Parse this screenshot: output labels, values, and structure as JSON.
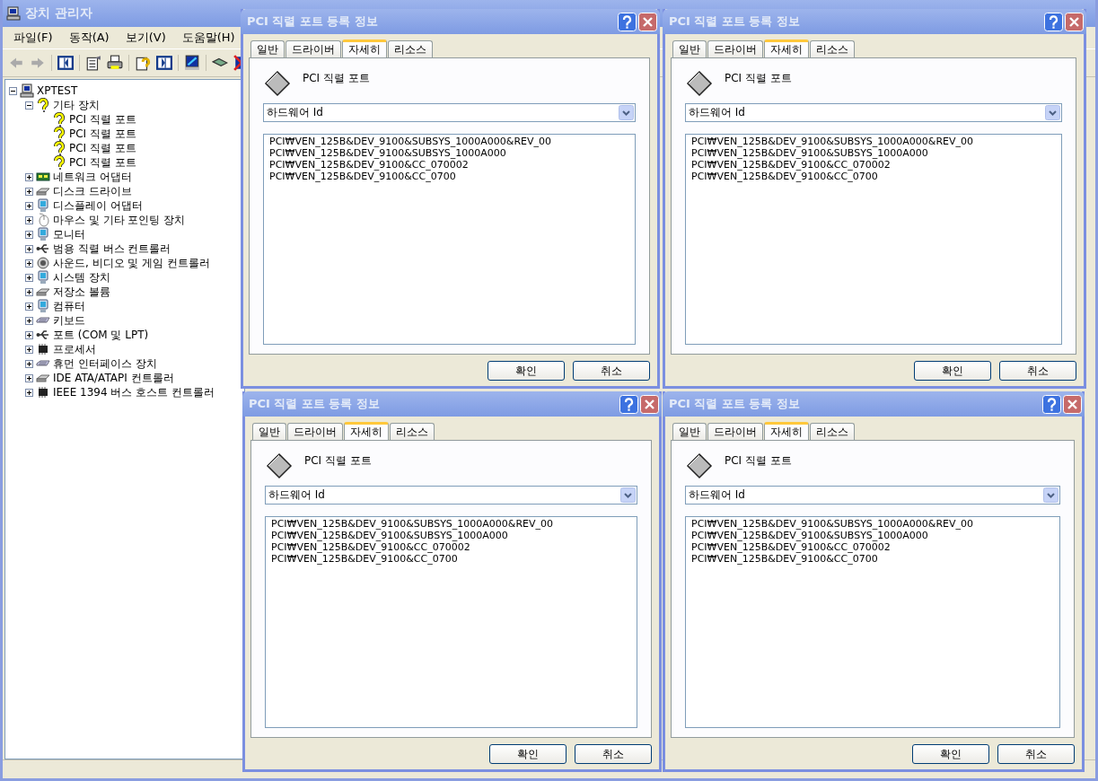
{
  "device_manager": {
    "title": "장치 관리자",
    "menu": [
      "파일(F)",
      "동작(A)",
      "보기(V)",
      "도움말(H)"
    ],
    "tree": [
      {
        "label": "XPTEST",
        "kind": "computer",
        "expanded": true,
        "children": [
          {
            "label": "기타 장치",
            "kind": "unknown",
            "expanded": true,
            "children": [
              {
                "label": "PCI 직렬 포트",
                "kind": "warning"
              },
              {
                "label": "PCI 직렬 포트",
                "kind": "warning"
              },
              {
                "label": "PCI 직렬 포트",
                "kind": "warning"
              },
              {
                "label": "PCI 직렬 포트",
                "kind": "warning"
              }
            ]
          },
          {
            "label": "네트워크 어댑터",
            "kind": "network",
            "expanded": false
          },
          {
            "label": "디스크 드라이브",
            "kind": "disk",
            "expanded": false
          },
          {
            "label": "디스플레이 어댑터",
            "kind": "display",
            "expanded": false
          },
          {
            "label": "마우스 및 기타 포인팅 장치",
            "kind": "mouse",
            "expanded": false
          },
          {
            "label": "모니터",
            "kind": "display",
            "expanded": false
          },
          {
            "label": "범용 직렬 버스 컨트롤러",
            "kind": "usb",
            "expanded": false
          },
          {
            "label": "사운드, 비디오 및 게임 컨트롤러",
            "kind": "sound",
            "expanded": false
          },
          {
            "label": "시스템 장치",
            "kind": "display",
            "expanded": false
          },
          {
            "label": "저장소 볼륨",
            "kind": "disk",
            "expanded": false
          },
          {
            "label": "컴퓨터",
            "kind": "display",
            "expanded": false
          },
          {
            "label": "키보드",
            "kind": "keyboard",
            "expanded": false
          },
          {
            "label": "포트 (COM 및 LPT)",
            "kind": "port",
            "expanded": false
          },
          {
            "label": "프로세서",
            "kind": "chip",
            "expanded": false
          },
          {
            "label": "휴먼 인터페이스 장치",
            "kind": "keyboard",
            "expanded": false
          },
          {
            "label": "IDE ATA/ATAPI 컨트롤러",
            "kind": "disk",
            "expanded": false
          },
          {
            "label": "IEEE 1394 버스 호스트 컨트롤러",
            "kind": "chip",
            "expanded": false
          }
        ]
      }
    ]
  },
  "dialogs": [
    {
      "title": "PCI 직렬 포트 등록 정보",
      "tabs": [
        {
          "label": "일반",
          "selected": false
        },
        {
          "label": "드라이버",
          "selected": false
        },
        {
          "label": "자세히",
          "selected": true
        },
        {
          "label": "리소스",
          "selected": false
        }
      ],
      "device_name": "PCI 직렬 포트",
      "property": "하드웨어 Id",
      "values": [
        "PCI₩VEN_125B&DEV_9100&SUBSYS_1000A000&REV_00",
        "PCI₩VEN_125B&DEV_9100&SUBSYS_1000A000",
        "PCI₩VEN_125B&DEV_9100&CC_070002",
        "PCI₩VEN_125B&DEV_9100&CC_0700"
      ],
      "buttons": [
        "확인",
        "취소"
      ]
    },
    {
      "title": "PCI 직렬 포트 등록 정보",
      "tabs": [
        {
          "label": "일반",
          "selected": false
        },
        {
          "label": "드라이버",
          "selected": false
        },
        {
          "label": "자세히",
          "selected": true
        },
        {
          "label": "리소스",
          "selected": false
        }
      ],
      "device_name": "PCI 직렬 포트",
      "property": "하드웨어 Id",
      "values": [
        "PCI₩VEN_125B&DEV_9100&SUBSYS_1000A000&REV_00",
        "PCI₩VEN_125B&DEV_9100&SUBSYS_1000A000",
        "PCI₩VEN_125B&DEV_9100&CC_070002",
        "PCI₩VEN_125B&DEV_9100&CC_0700"
      ],
      "buttons": [
        "확인",
        "취소"
      ]
    },
    {
      "title": "PCI 직렬 포트 등록 정보",
      "tabs": [
        {
          "label": "일반",
          "selected": false
        },
        {
          "label": "드라이버",
          "selected": false
        },
        {
          "label": "자세히",
          "selected": true
        },
        {
          "label": "리소스",
          "selected": false
        }
      ],
      "device_name": "PCI 직렬 포트",
      "property": "하드웨어 Id",
      "values": [
        "PCI₩VEN_125B&DEV_9100&SUBSYS_1000A000&REV_00",
        "PCI₩VEN_125B&DEV_9100&SUBSYS_1000A000",
        "PCI₩VEN_125B&DEV_9100&CC_070002",
        "PCI₩VEN_125B&DEV_9100&CC_0700"
      ],
      "buttons": [
        "확인",
        "취소"
      ]
    },
    {
      "title": "PCI 직렬 포트 등록 정보",
      "tabs": [
        {
          "label": "일반",
          "selected": false
        },
        {
          "label": "드라이버",
          "selected": false
        },
        {
          "label": "자세히",
          "selected": true
        },
        {
          "label": "리소스",
          "selected": false
        }
      ],
      "device_name": "PCI 직렬 포트",
      "property": "하드웨어 Id",
      "values": [
        "PCI₩VEN_125B&DEV_9100&SUBSYS_1000A000&REV_00",
        "PCI₩VEN_125B&DEV_9100&SUBSYS_1000A000",
        "PCI₩VEN_125B&DEV_9100&CC_070002",
        "PCI₩VEN_125B&DEV_9100&CC_0700"
      ],
      "buttons": [
        "확인",
        "취소"
      ]
    }
  ]
}
